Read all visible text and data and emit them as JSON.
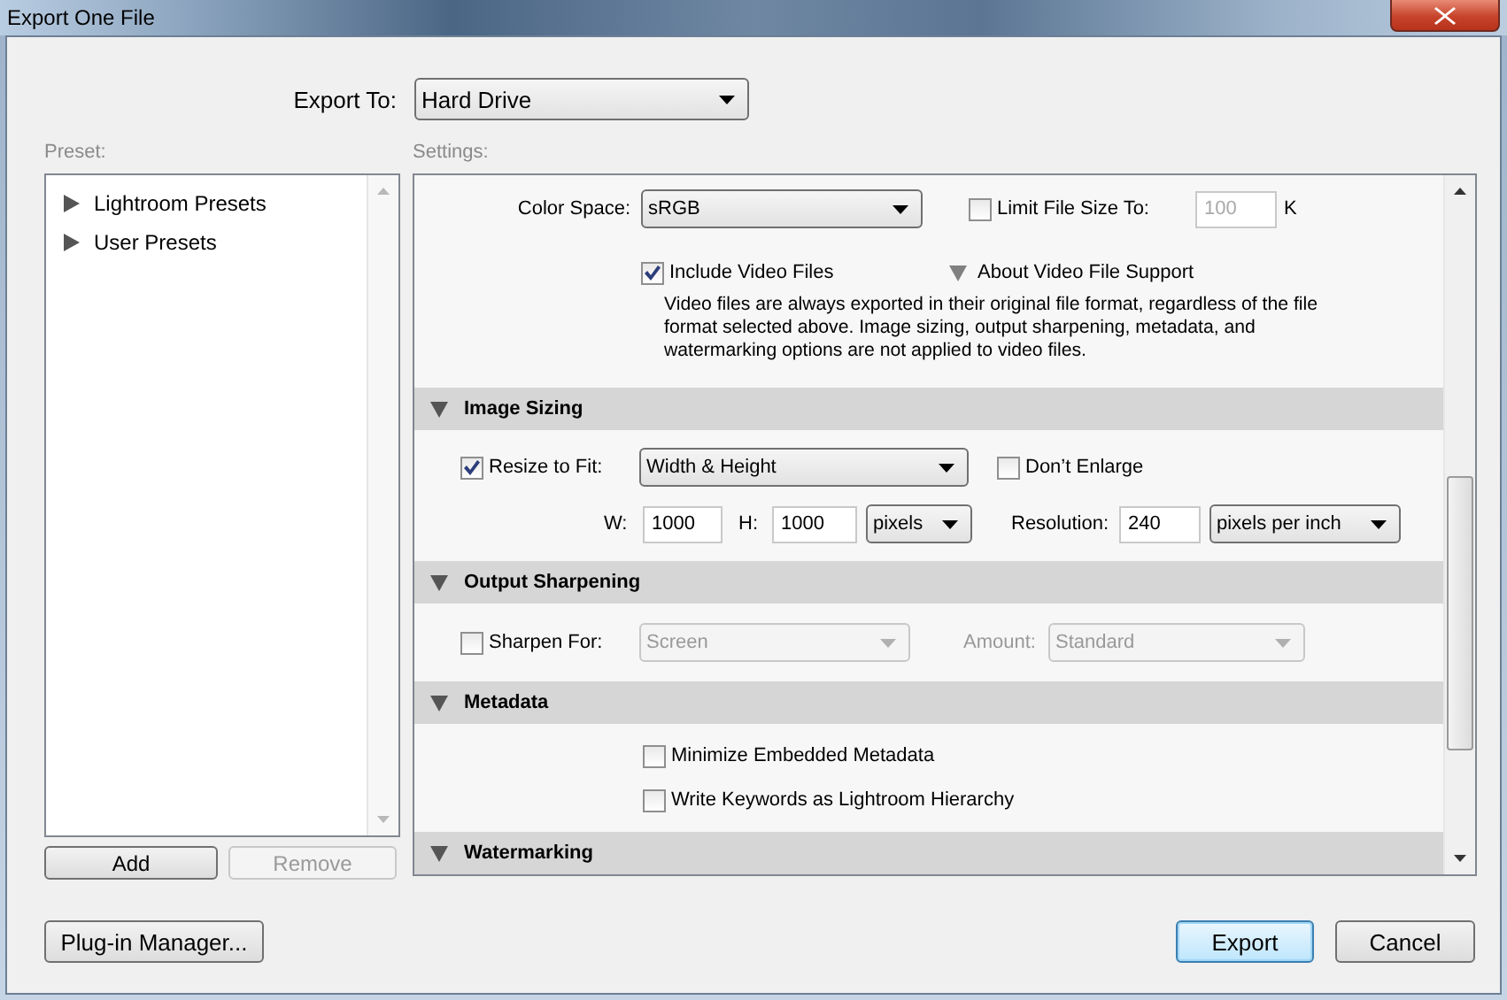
{
  "window": {
    "title": "Export One File"
  },
  "export_to": {
    "label": "Export To:",
    "value": "Hard Drive"
  },
  "preset": {
    "label": "Preset:",
    "items": [
      {
        "label": "Lightroom Presets",
        "expanded": false
      },
      {
        "label": "User Presets",
        "expanded": false
      }
    ],
    "buttons": [
      {
        "label": "Add",
        "disabled": false
      },
      {
        "label": "Remove",
        "disabled": true
      }
    ]
  },
  "settings": {
    "label": "Settings:",
    "sections": [
      {
        "lines": [
          {
            "items": [
              {
                "kind": "label",
                "text": "Color Space:",
                "disabled": false
              },
              {
                "kind": "select",
                "value": "sRGB",
                "disabled": false
              },
              {
                "kind": "checkbox",
                "label": "Limit File Size To:",
                "checked": false
              },
              {
                "kind": "input",
                "value": "100",
                "disabled": true
              },
              {
                "kind": "label",
                "text": "K",
                "disabled": false
              }
            ]
          },
          {
            "items": [
              {
                "kind": "checkbox",
                "label": "Include Video Files",
                "checked": true
              },
              {
                "kind": "disclosure",
                "label": "About Video File Support",
                "expanded": true
              }
            ]
          },
          {
            "items": [
              {
                "kind": "note",
                "text": "Video files are always exported in their original file format, regardless of the file format selected above. Image sizing, output sharpening, metadata, and watermarking options are not applied to video files."
              }
            ]
          }
        ]
      },
      {
        "title": "Image Sizing",
        "expanded": true,
        "lines": [
          {
            "items": [
              {
                "kind": "checkbox",
                "label": "Resize to Fit:",
                "checked": true
              },
              {
                "kind": "select",
                "value": "Width & Height",
                "disabled": false
              },
              {
                "kind": "checkbox",
                "label": "Don’t Enlarge",
                "checked": false
              }
            ]
          },
          {
            "items": [
              {
                "kind": "label",
                "text": "W:",
                "disabled": false
              },
              {
                "kind": "input",
                "value": "1000",
                "disabled": false
              },
              {
                "kind": "label",
                "text": "H:",
                "disabled": false
              },
              {
                "kind": "input",
                "value": "1000",
                "disabled": false
              },
              {
                "kind": "select",
                "value": "pixels",
                "disabled": false
              },
              {
                "kind": "label",
                "text": "Resolution:",
                "disabled": false
              },
              {
                "kind": "input",
                "value": "240",
                "disabled": false
              },
              {
                "kind": "select",
                "value": "pixels per inch",
                "disabled": false
              }
            ]
          }
        ]
      },
      {
        "title": "Output Sharpening",
        "expanded": true,
        "lines": [
          {
            "items": [
              {
                "kind": "checkbox",
                "label": "Sharpen For:",
                "checked": false
              },
              {
                "kind": "select",
                "value": "Screen",
                "disabled": true
              },
              {
                "kind": "label",
                "text": "Amount:",
                "disabled": true
              },
              {
                "kind": "select",
                "value": "Standard",
                "disabled": true
              }
            ]
          }
        ]
      },
      {
        "title": "Metadata",
        "expanded": true,
        "lines": [
          {
            "items": [
              {
                "kind": "checkbox",
                "label": "Minimize Embedded Metadata",
                "checked": false
              }
            ]
          },
          {
            "items": [
              {
                "kind": "checkbox",
                "label": "Write Keywords as Lightroom Hierarchy",
                "checked": false
              }
            ]
          }
        ]
      },
      {
        "title": "Watermarking",
        "expanded": true
      }
    ]
  },
  "footer": {
    "buttons": [
      {
        "label": "Plug-in Manager...",
        "default": false
      },
      {
        "label": "Export",
        "default": true
      },
      {
        "label": "Cancel",
        "default": false
      }
    ]
  }
}
